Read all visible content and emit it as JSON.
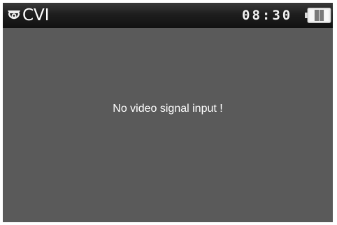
{
  "status_bar": {
    "mode": "CVI",
    "time": "08:30",
    "camera_icon": "dome-camera-icon",
    "battery_icon": "battery-icon",
    "battery_level": 0.75
  },
  "screen": {
    "message": "No video signal input !",
    "background_color": "#5a5a5a"
  }
}
